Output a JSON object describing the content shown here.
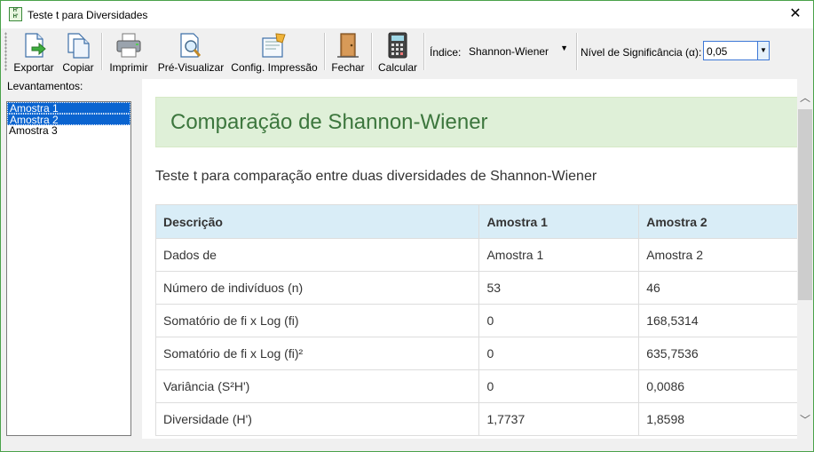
{
  "window": {
    "title": "Teste t para Diversidades",
    "icon_text": "H'\nH'",
    "close_glyph": "✕"
  },
  "toolbar": {
    "buttons": [
      {
        "label": "Exportar",
        "icon": "export-icon"
      },
      {
        "label": "Copiar",
        "icon": "copy-icon"
      },
      {
        "label": "Imprimir",
        "icon": "printer-icon"
      },
      {
        "label": "Pré-Visualizar",
        "icon": "print-preview-icon"
      },
      {
        "label": "Config. Impressão",
        "icon": "page-setup-icon"
      },
      {
        "label": "Fechar",
        "icon": "door-icon"
      },
      {
        "label": "Calcular",
        "icon": "calculator-icon"
      }
    ],
    "indice_label": "Índice:",
    "indice_value": "Shannon-Wiener",
    "nivel_label": "Nível de Significância (α):",
    "nivel_value": "0,05"
  },
  "sidebar": {
    "label": "Levantamentos:",
    "items": [
      {
        "label": "Amostra 1",
        "selected": true
      },
      {
        "label": "Amostra 2",
        "selected": true
      },
      {
        "label": "Amostra 3",
        "selected": false
      }
    ]
  },
  "report": {
    "title": "Comparação de Shannon-Wiener",
    "subtitle": "Teste t para comparação entre duas diversidades de Shannon-Wiener",
    "headers": [
      "Descrição",
      "Amostra 1",
      "Amostra 2"
    ],
    "rows": [
      [
        "Dados de",
        "Amostra 1",
        "Amostra 2"
      ],
      [
        "Número de indivíduos (n)",
        "53",
        "46"
      ],
      [
        "Somatório de fi x Log (fi)",
        "0",
        "168,5314"
      ],
      [
        "Somatório de fi x Log (fi)²",
        "0",
        "635,7536"
      ],
      [
        "Variância (S²H')",
        "0",
        "0,0086"
      ],
      [
        "Diversidade (H')",
        "1,7737",
        "1,8598"
      ]
    ]
  },
  "colors": {
    "banner_bg": "#dff0d8",
    "banner_text": "#3c763d",
    "table_header_bg": "#d9edf7",
    "selection": "#0a64d0",
    "window_border": "#4aa24a"
  }
}
